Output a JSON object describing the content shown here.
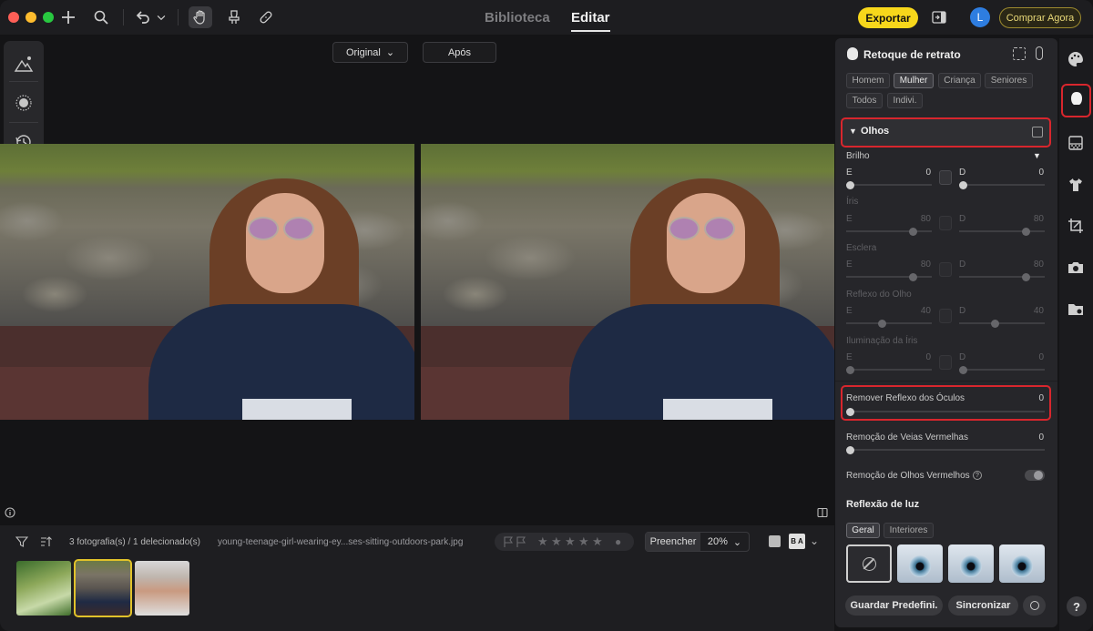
{
  "topbar": {
    "tab_library": "Biblioteca",
    "tab_edit": "Editar",
    "export_label": "Exportar",
    "avatar_letter": "L",
    "buy_label": "Comprar Agora"
  },
  "compare": {
    "original_label": "Original",
    "after_label": "Após"
  },
  "filmstrip": {
    "count_text": "3 fotografia(s) / 1 delecionado(s)",
    "filename": "young-teenage-girl-wearing-ey...ses-sitting-outdoors-park.jpg",
    "fill_label": "Preencher",
    "zoom_value": "20%",
    "ab_label": "B A"
  },
  "panel": {
    "title": "Retoque de retrato",
    "chips": [
      "Homem",
      "Mulher",
      "Criança",
      "Seniores",
      "Todos",
      "Indivi."
    ],
    "section": "Olhos",
    "brightness": {
      "label": "Brilho",
      "left_letter": "E",
      "left_value": "0",
      "right_letter": "D",
      "right_value": "0"
    },
    "iris": {
      "label": "Íris",
      "left_letter": "E",
      "left_value": "80",
      "right_letter": "D",
      "right_value": "80"
    },
    "sclera": {
      "label": "Esclera",
      "left_letter": "E",
      "left_value": "80",
      "right_letter": "D",
      "right_value": "80"
    },
    "eye_reflex": {
      "label": "Reflexo do Olho",
      "left_letter": "E",
      "left_value": "40",
      "right_letter": "D",
      "right_value": "40"
    },
    "iris_light": {
      "label": "Iluminação da Íris",
      "left_letter": "E",
      "left_value": "0",
      "right_letter": "D",
      "right_value": "0"
    },
    "glasses_reflex": {
      "label": "Remover Reflexo dos Óculos",
      "value": "0"
    },
    "red_veins": {
      "label": "Remoção de Veias Vermelhas",
      "value": "0"
    },
    "red_eyes": {
      "label": "Remoção de Olhos Vermelhos"
    },
    "light_reflection": {
      "title": "Reflexão de luz",
      "tab_general": "Geral",
      "tab_interior": "Interiores"
    },
    "save_preset": "Guardar Predefini.",
    "sync": "Sincronizar"
  },
  "rail": {
    "help": "?"
  },
  "colors": {
    "accent": "#f7d71b",
    "highlight": "#d8262d",
    "avatar": "#2e7de0"
  }
}
